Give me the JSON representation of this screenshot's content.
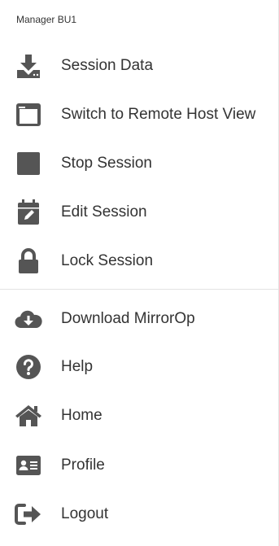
{
  "header": {
    "title": "Manager BU1"
  },
  "menu": {
    "items": [
      {
        "label": "Session Data",
        "icon": "download-icon"
      },
      {
        "label": "Switch to Remote Host View",
        "icon": "window-icon"
      },
      {
        "label": "Stop Session",
        "icon": "stop-icon"
      },
      {
        "label": "Edit Session",
        "icon": "calendar-edit-icon"
      },
      {
        "label": "Lock Session",
        "icon": "lock-icon"
      },
      {
        "label": "Download MirrorOp",
        "icon": "cloud-download-icon"
      },
      {
        "label": "Help",
        "icon": "help-icon"
      },
      {
        "label": "Home",
        "icon": "home-icon"
      },
      {
        "label": "Profile",
        "icon": "profile-card-icon"
      },
      {
        "label": "Logout",
        "icon": "logout-icon"
      }
    ]
  },
  "colors": {
    "icon": "#555555",
    "text": "#333333",
    "divider": "#e3e3e3"
  }
}
